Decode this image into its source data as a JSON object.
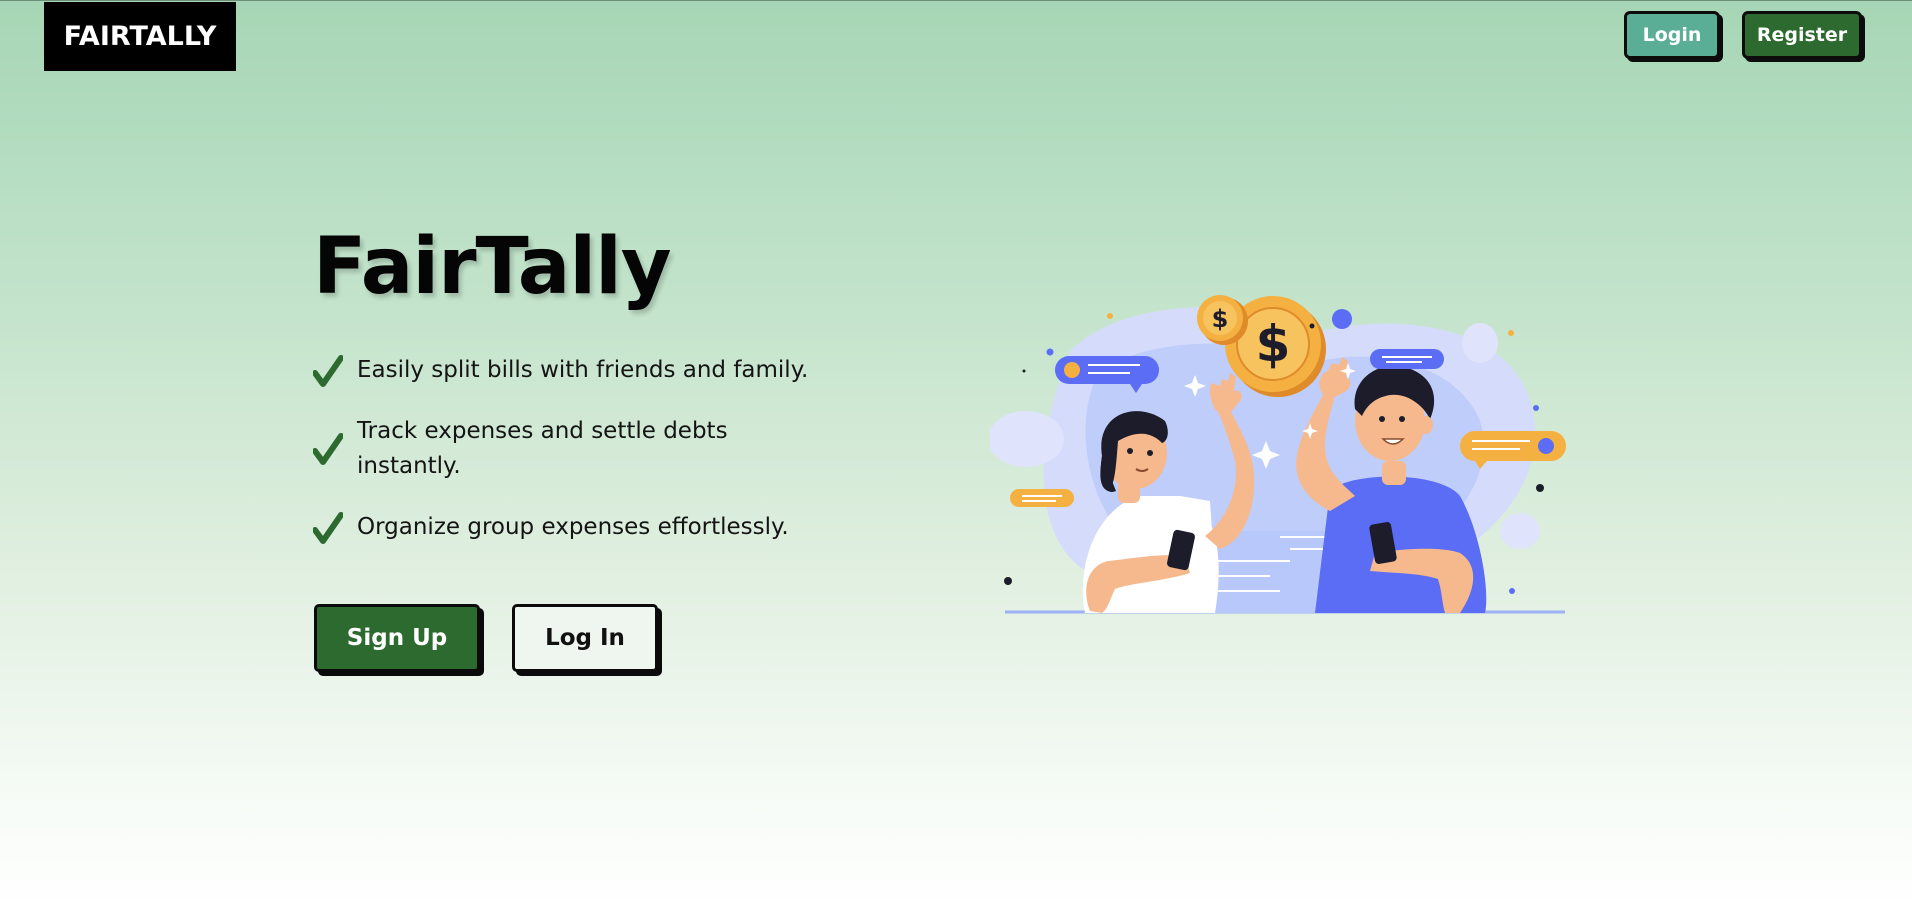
{
  "header": {
    "logo_text": "FAIRTALLY",
    "login_label": "Login",
    "register_label": "Register"
  },
  "hero": {
    "title": "FairTally",
    "features": [
      "Easily split bills with friends and family.",
      "Track expenses and settle debts instantly.",
      "Organize group expenses effortlessly."
    ],
    "signup_label": "Sign Up",
    "login_label": "Log In",
    "illustration": {
      "coin_symbol_large": "$",
      "coin_symbol_small": "$"
    }
  },
  "colors": {
    "primary_green": "#2d6a30",
    "login_teal": "#5aae95",
    "background_top": "#a6d6b5",
    "check_green": "#2d6a30",
    "coin_orange": "#f5b042",
    "blue_accent": "#5b6df5"
  },
  "icons": {
    "check": "checkmark-icon"
  }
}
